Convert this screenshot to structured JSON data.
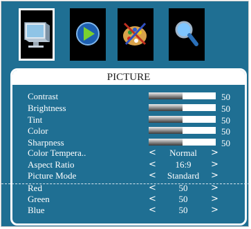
{
  "menu_icons": [
    {
      "name": "picture-icon",
      "selected": true
    },
    {
      "name": "sound-icon",
      "selected": false
    },
    {
      "name": "setup-icon",
      "selected": false
    },
    {
      "name": "search-icon",
      "selected": false
    }
  ],
  "panel": {
    "title": "PICTURE"
  },
  "sliders": [
    {
      "label": "Contrast",
      "value": 50,
      "value_text": "50"
    },
    {
      "label": "Brightness",
      "value": 50,
      "value_text": "50"
    },
    {
      "label": "Tint",
      "value": 50,
      "value_text": "50"
    },
    {
      "label": "Color",
      "value": 50,
      "value_text": "50"
    },
    {
      "label": "Sharpness",
      "value": 50,
      "value_text": "50"
    }
  ],
  "selectors": [
    {
      "label": "Color Tempera..",
      "value": "Normal"
    },
    {
      "label": "Aspect Ratio",
      "value": "16:9"
    },
    {
      "label": "Picture Mode",
      "value": "Standard"
    },
    {
      "label": "Red",
      "value": "50"
    },
    {
      "label": "Green",
      "value": "50"
    },
    {
      "label": "Blue",
      "value": "50"
    }
  ],
  "arrow_left": "<",
  "arrow_right": ">",
  "colors": {
    "background": "#1f6f93",
    "frame": "#ffffff",
    "text": "#ffffff"
  }
}
